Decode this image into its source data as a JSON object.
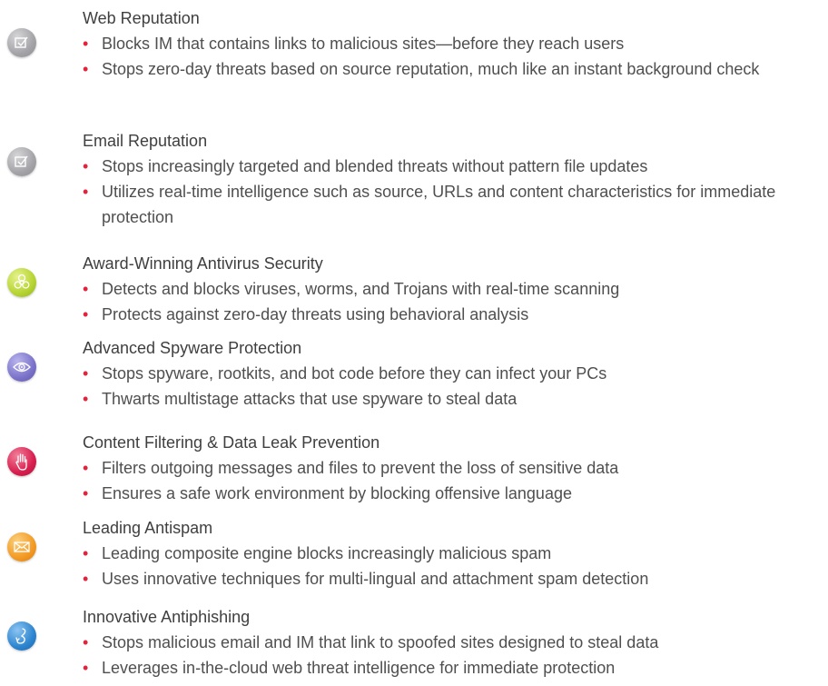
{
  "features": [
    {
      "title": "Web Reputation",
      "icon": "checkbox-icon",
      "color": "#a9a9ad",
      "bullets": [
        "Blocks IM that contains links to malicious sites—before they reach users",
        "Stops zero-day threats based on source reputation, much like an instant background check"
      ]
    },
    {
      "title": "Email Reputation",
      "icon": "checkbox-icon",
      "color": "#a9a9ad",
      "bullets": [
        "Stops increasingly targeted and blended threats without pattern file updates",
        "Utilizes real-time intelligence such as source, URLs and content characteristics for immediate protection"
      ]
    },
    {
      "title": "Award-Winning Antivirus Security",
      "icon": "biohazard-icon",
      "color": "#b6d432",
      "bullets": [
        "Detects and blocks viruses, worms, and Trojans with real-time scanning",
        "Protects against zero-day threats using behavioral analysis"
      ]
    },
    {
      "title": "Advanced Spyware Protection",
      "icon": "eye-icon",
      "color": "#7b73c9",
      "bullets": [
        "Stops spyware, rootkits, and bot code before they can infect your PCs",
        "Thwarts multistage attacks that use spyware to steal data"
      ]
    },
    {
      "title": "Content Filtering & Data Leak Prevention",
      "icon": "hand-icon",
      "color": "#d81f4f",
      "bullets": [
        "Filters outgoing messages and files to prevent the loss of sensitive data",
        "Ensures a safe work environment by blocking offensive language"
      ]
    },
    {
      "title": "Leading Antispam",
      "icon": "envelope-icon",
      "color": "#f39a25",
      "bullets": [
        "Leading composite engine blocks increasingly malicious spam",
        "Uses innovative techniques for multi-lingual and attachment spam detection"
      ]
    },
    {
      "title": "Innovative Antiphishing",
      "icon": "fishhook-icon",
      "color": "#2d85cf",
      "bullets": [
        "Stops malicious email and IM that link to spoofed sites designed to steal data",
        "Leverages in-the-cloud web threat intelligence for immediate protection"
      ]
    }
  ],
  "bullet_color": "#e2233b"
}
